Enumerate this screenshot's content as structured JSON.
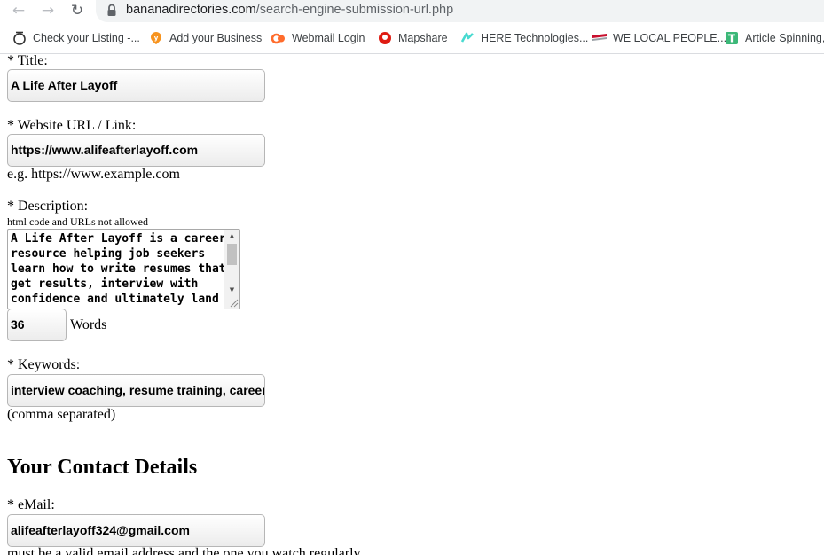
{
  "browser": {
    "url_host": "bananadirectories.com",
    "url_path": "/search-engine-submission-url.php",
    "bookmarks": [
      {
        "label": "Check your Listing -...",
        "icon": "circle-icon"
      },
      {
        "label": "Add your Business",
        "icon": "yelp-pin-icon"
      },
      {
        "label": "Webmail Login",
        "icon": "cpanel-icon"
      },
      {
        "label": "Mapshare",
        "icon": "tomtom-icon"
      },
      {
        "label": "HERE Technologies...",
        "icon": "here-icon"
      },
      {
        "label": "WE LOCAL PEOPLE...",
        "icon": "flag-icon"
      },
      {
        "label": "Article Spinning,",
        "icon": "t-logo-icon"
      }
    ]
  },
  "form": {
    "title_label": "* Title:",
    "title_value": "A Life After Layoff",
    "url_label": "* Website URL / Link:",
    "url_value": "https://www.alifeafterlayoff.com",
    "url_hint": "e.g. https://www.example.com",
    "description_label": "* Description:",
    "description_hint": "html code and URLs not allowed",
    "description_value": "A Life After Layoff is a career\nresource helping job seekers\nlearn how to write resumes that\nget results, interview with\nconfidence and ultimately land",
    "word_count": "36",
    "words_label": "Words",
    "keywords_label": "* Keywords:",
    "keywords_value": "interview coaching, resume training, career",
    "keywords_hint": "(comma separated)",
    "contact_heading": "Your Contact Details",
    "email_label": "* eMail:",
    "email_value": "alifeafterlayoff324@gmail.com",
    "email_hint": "must be a valid email address and the one you watch regularly"
  },
  "colors": {
    "omnibox_bg": "#f1f3f4",
    "tab_text": "#3c4043",
    "field_border": "#b6b6b6"
  }
}
